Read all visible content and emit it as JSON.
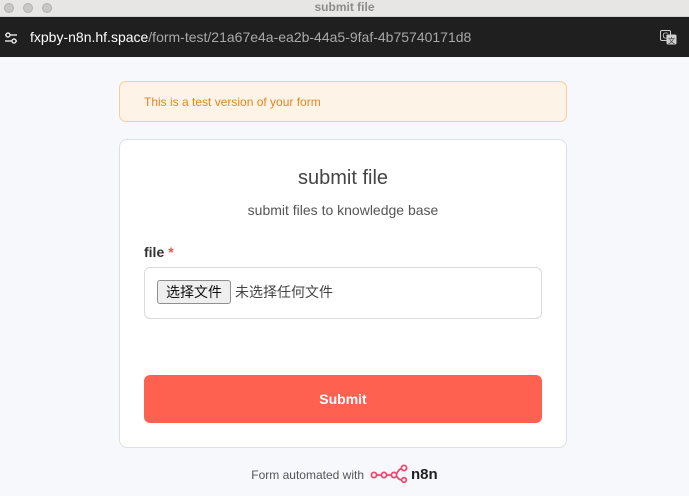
{
  "window": {
    "title": "submit file"
  },
  "urlbar": {
    "host": "fxpby-n8n.hf.space",
    "path": "/form-test/21a67e4a-ea2b-44a5-9faf-4b75740171d8"
  },
  "notice": {
    "text": "This is a test version of your form"
  },
  "form": {
    "title": "submit file",
    "subtitle": "submit files to knowledge base",
    "field_label": "file",
    "required_mark": "*",
    "choose_button": "选择文件",
    "no_file_text": "未选择任何文件",
    "submit_label": "Submit"
  },
  "footer": {
    "text": "Form automated with",
    "brand": "n8n"
  },
  "colors": {
    "accent": "#ff6150",
    "notice_bg": "#fdf3e7",
    "notice_text": "#e0871f",
    "brand_logo": "#ea4b71"
  },
  "icons": {
    "site_settings": "site-settings-icon",
    "translate": "translate-icon",
    "n8n_logo": "n8n-logo-icon"
  }
}
